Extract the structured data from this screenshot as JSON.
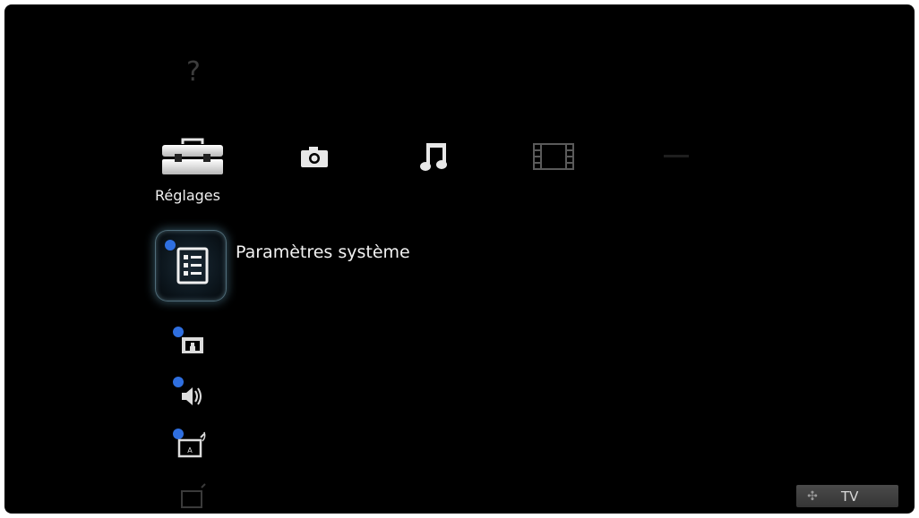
{
  "help": {
    "icon": "question-icon",
    "glyph": "?"
  },
  "categories": [
    {
      "id": "settings",
      "icon": "toolbox-icon",
      "label": "Réglages",
      "selected": true
    },
    {
      "id": "photo",
      "icon": "camera-icon"
    },
    {
      "id": "music",
      "icon": "music-note-icon"
    },
    {
      "id": "video",
      "icon": "film-strip-icon"
    },
    {
      "id": "next",
      "icon": "dim-category-icon"
    }
  ],
  "submenu": {
    "selected": {
      "icon": "system-settings-icon",
      "label": "Paramètres système"
    },
    "items": [
      {
        "icon": "picture-settings-icon"
      },
      {
        "icon": "sound-settings-icon"
      },
      {
        "icon": "channel-settings-icon"
      },
      {
        "icon": "dim-settings-icon"
      }
    ]
  },
  "footer": {
    "dpad_icon": "dpad-icon",
    "dpad_glyph": "✣",
    "tv_label": "TV"
  },
  "colors": {
    "background": "#000000",
    "badge": "#2f6fe0",
    "selection_glow": "#78bedc"
  }
}
